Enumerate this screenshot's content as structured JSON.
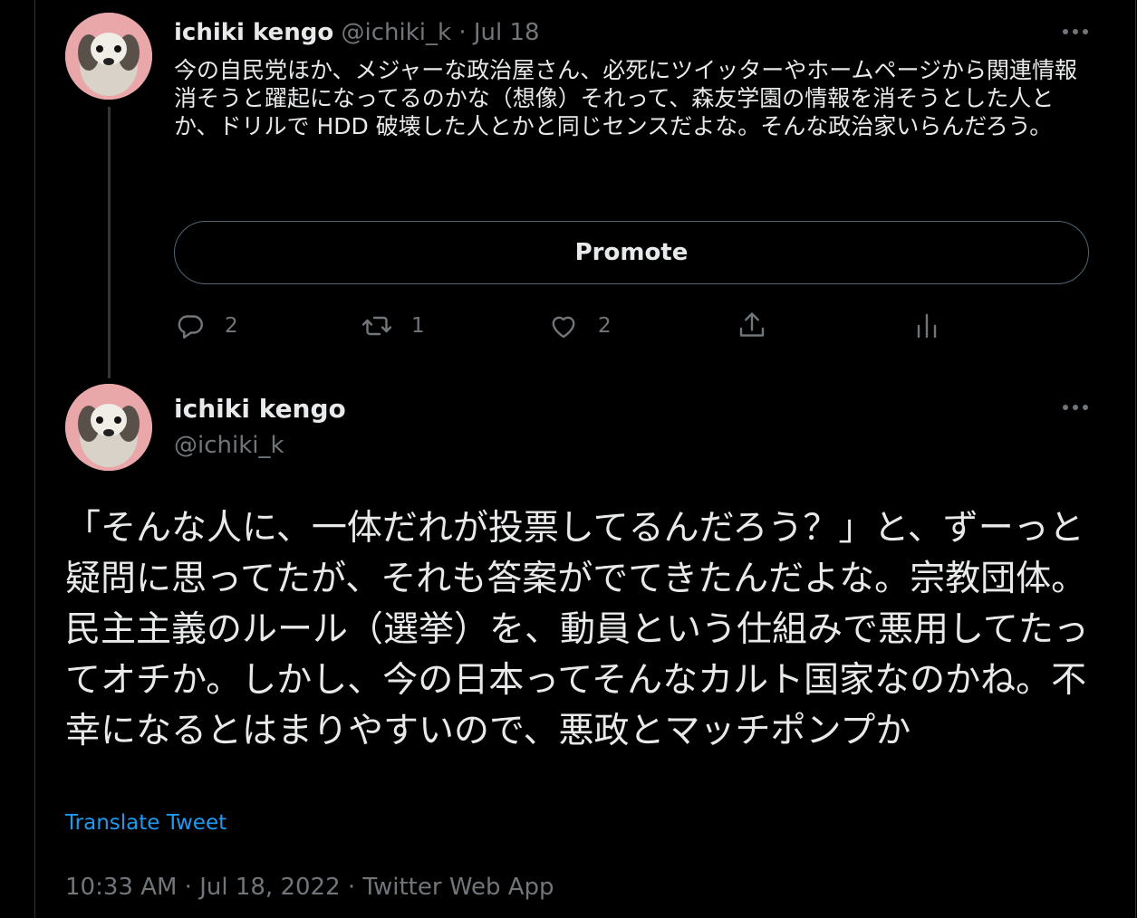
{
  "tweet1": {
    "name": "ichiki kengo",
    "handle": "@ichiki_k",
    "sep": "·",
    "date": "Jul 18",
    "text": "今の自民党ほか、メジャーな政治屋さん、必死にツイッターやホームページから関連情報消そうと躍起になってるのかな（想像）それって、森友学園の情報を消そうとした人とか、ドリルで HDD 破壊した人とかと同じセンスだよな。そんな政治家いらんだろう。",
    "promote_label": "Promote",
    "replies": "2",
    "retweets": "1",
    "likes": "2"
  },
  "tweet2": {
    "name": "ichiki kengo",
    "handle": "@ichiki_k",
    "text": "「そんな人に、一体だれが投票してるんだろう？」と、ずーっと疑問に思ってたが、それも答案がでてきたんだよな。宗教団体。民主主義のルール（選挙）を、動員という仕組みで悪用してたってオチか。しかし、今の日本ってそんなカルト国家なのかね。不幸になるとはまりやすいので、悪政とマッチポンプか",
    "translate_label": "Translate Tweet",
    "meta": "10:33 AM · Jul 18, 2022 · Twitter Web App"
  },
  "icons": [
    "more-icon",
    "reply-icon",
    "retweet-icon",
    "like-icon",
    "share-icon",
    "analytics-icon"
  ],
  "colors": {
    "background": "#000000",
    "text": "#e7e9ea",
    "muted": "#71767b",
    "link": "#1d9bf0",
    "border": "#2f3336"
  }
}
